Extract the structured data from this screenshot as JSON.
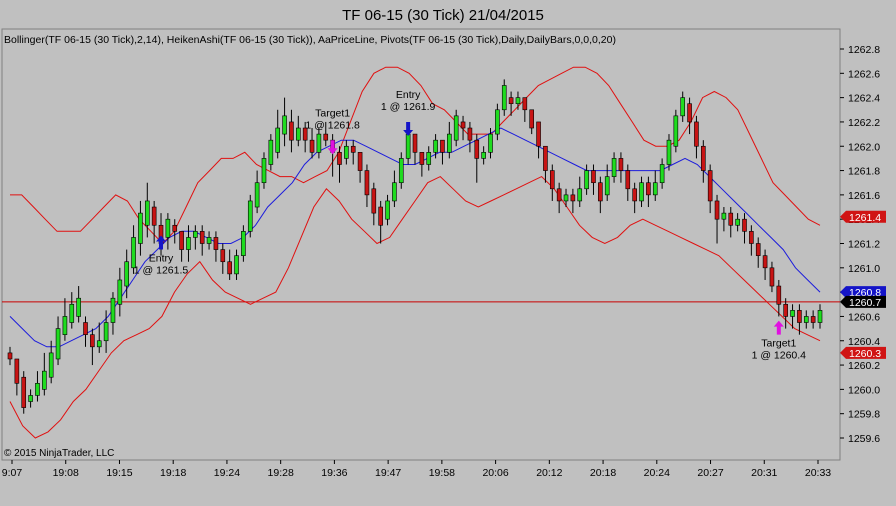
{
  "title": "TF 06-15 (30 Tick)  21/04/2015",
  "indicator_line": "Bollinger(TF 06-15 (30 Tick),2,14), HeikenAshi(TF 06-15 (30 Tick)), AaPriceLine, Pivots(TF 06-15 (30 Tick),Daily,DailyBars,0,0,0,20)",
  "copyright": "© 2015 NinjaTrader, LLC",
  "colors": {
    "background": "#c0c0c0",
    "bull_candle": "#1fdc1f",
    "bear_candle": "#c81414",
    "bollinger_band": "#e01010",
    "bollinger_mid": "#1c1cdc",
    "price_line": "#c80000",
    "entry_arrow": "#1414c8",
    "exit_arrow": "#e010e0"
  },
  "chart_data": {
    "type": "candlestick",
    "y_axis": {
      "min": 1259.6,
      "max": 1262.8,
      "ticks": [
        "1262.8",
        "1262.6",
        "1262.4",
        "1262.2",
        "1262.0",
        "1261.8",
        "1261.6",
        "1261.4",
        "1261.2",
        "1261.0",
        "1260.8",
        "1260.6",
        "1260.4",
        "1260.2",
        "1260.0",
        "1259.8",
        "1259.6"
      ]
    },
    "x_axis": {
      "ticks": [
        "9:07",
        "19:08",
        "19:15",
        "19:18",
        "19:24",
        "19:28",
        "19:36",
        "19:47",
        "19:58",
        "20:06",
        "20:12",
        "20:18",
        "20:24",
        "20:27",
        "20:31",
        "20:33"
      ]
    },
    "axis_badges": [
      {
        "label": "1261.4",
        "value": 1261.42,
        "bg": "#d01414",
        "fg": "#ffffff"
      },
      {
        "label": "1260.8",
        "value": 1260.8,
        "bg": "#1414c8",
        "fg": "#ffffff"
      },
      {
        "label": "1260.7",
        "value": 1260.72,
        "bg": "#000000",
        "fg": "#ffffff"
      },
      {
        "label": "1260.3",
        "value": 1260.3,
        "bg": "#d01414",
        "fg": "#ffffff"
      }
    ],
    "price_line": 1260.72,
    "candles": [
      [
        1260.3,
        1260.25,
        1260.35,
        1260.2
      ],
      [
        1260.25,
        1260.05,
        1260.25,
        1259.95
      ],
      [
        1260.1,
        1259.85,
        1260.15,
        1259.8
      ],
      [
        1259.9,
        1259.95,
        1260.0,
        1259.85
      ],
      [
        1259.95,
        1260.05,
        1260.15,
        1259.9
      ],
      [
        1260.0,
        1260.15,
        1260.3,
        1259.95
      ],
      [
        1260.1,
        1260.3,
        1260.4,
        1260.05
      ],
      [
        1260.25,
        1260.5,
        1260.6,
        1260.2
      ],
      [
        1260.45,
        1260.6,
        1260.75,
        1260.4
      ],
      [
        1260.55,
        1260.7,
        1260.8,
        1260.5
      ],
      [
        1260.6,
        1260.75,
        1260.85,
        1260.55
      ],
      [
        1260.55,
        1260.45,
        1260.6,
        1260.35
      ],
      [
        1260.45,
        1260.35,
        1260.5,
        1260.2
      ],
      [
        1260.35,
        1260.4,
        1260.55,
        1260.3
      ],
      [
        1260.4,
        1260.55,
        1260.65,
        1260.3
      ],
      [
        1260.55,
        1260.75,
        1260.8,
        1260.45
      ],
      [
        1260.7,
        1260.9,
        1261.0,
        1260.6
      ],
      [
        1260.85,
        1261.05,
        1261.15,
        1260.75
      ],
      [
        1261.0,
        1261.25,
        1261.35,
        1260.95
      ],
      [
        1261.2,
        1261.45,
        1261.55,
        1261.1
      ],
      [
        1261.35,
        1261.55,
        1261.7,
        1261.25
      ],
      [
        1261.5,
        1261.35,
        1261.55,
        1261.2
      ],
      [
        1261.35,
        1261.2,
        1261.45,
        1261.1
      ],
      [
        1261.25,
        1261.4,
        1261.45,
        1261.15
      ],
      [
        1261.35,
        1261.3,
        1261.4,
        1261.2
      ],
      [
        1261.3,
        1261.15,
        1261.3,
        1261.05
      ],
      [
        1261.15,
        1261.25,
        1261.35,
        1261.05
      ],
      [
        1261.25,
        1261.3,
        1261.35,
        1261.15
      ],
      [
        1261.3,
        1261.2,
        1261.35,
        1261.1
      ],
      [
        1261.2,
        1261.25,
        1261.3,
        1261.15
      ],
      [
        1261.25,
        1261.15,
        1261.3,
        1261.05
      ],
      [
        1261.15,
        1261.05,
        1261.2,
        1260.95
      ],
      [
        1261.05,
        1260.95,
        1261.15,
        1260.9
      ],
      [
        1260.95,
        1261.1,
        1261.15,
        1260.9
      ],
      [
        1261.1,
        1261.3,
        1261.35,
        1261.05
      ],
      [
        1261.3,
        1261.55,
        1261.6,
        1261.25
      ],
      [
        1261.5,
        1261.7,
        1261.8,
        1261.45
      ],
      [
        1261.7,
        1261.9,
        1261.95,
        1261.65
      ],
      [
        1261.85,
        1262.05,
        1262.1,
        1261.8
      ],
      [
        1261.95,
        1262.15,
        1262.3,
        1261.9
      ],
      [
        1262.1,
        1262.25,
        1262.4,
        1262.0
      ],
      [
        1262.2,
        1262.05,
        1262.3,
        1261.95
      ],
      [
        1262.05,
        1262.15,
        1262.25,
        1262.0
      ],
      [
        1262.15,
        1262.05,
        1262.2,
        1261.95
      ],
      [
        1262.05,
        1261.95,
        1262.15,
        1261.9
      ],
      [
        1261.95,
        1262.1,
        1262.15,
        1261.9
      ],
      [
        1262.1,
        1262.05,
        1262.2,
        1262.0
      ],
      [
        1262.05,
        1261.95,
        1262.1,
        1261.75
      ],
      [
        1261.95,
        1261.85,
        1262.0,
        1261.7
      ],
      [
        1261.9,
        1262.0,
        1262.05,
        1261.85
      ],
      [
        1262.0,
        1261.95,
        1262.05,
        1261.85
      ],
      [
        1261.95,
        1261.8,
        1261.95,
        1261.7
      ],
      [
        1261.8,
        1261.6,
        1261.85,
        1261.5
      ],
      [
        1261.65,
        1261.45,
        1261.7,
        1261.35
      ],
      [
        1261.5,
        1261.35,
        1261.55,
        1261.2
      ],
      [
        1261.4,
        1261.55,
        1261.6,
        1261.35
      ],
      [
        1261.55,
        1261.7,
        1261.8,
        1261.5
      ],
      [
        1261.7,
        1261.9,
        1261.95,
        1261.65
      ],
      [
        1261.9,
        1262.1,
        1262.15,
        1261.85
      ],
      [
        1262.1,
        1261.95,
        1262.1,
        1261.85
      ],
      [
        1261.95,
        1261.85,
        1261.95,
        1261.75
      ],
      [
        1261.85,
        1261.95,
        1262.0,
        1261.8
      ],
      [
        1261.95,
        1262.05,
        1262.1,
        1261.9
      ],
      [
        1262.05,
        1261.95,
        1262.05,
        1261.85
      ],
      [
        1261.95,
        1262.1,
        1262.2,
        1261.9
      ],
      [
        1262.05,
        1262.25,
        1262.3,
        1262.0
      ],
      [
        1262.2,
        1262.15,
        1262.25,
        1262.05
      ],
      [
        1262.15,
        1262.05,
        1262.2,
        1261.95
      ],
      [
        1262.05,
        1261.9,
        1262.1,
        1261.7
      ],
      [
        1261.9,
        1261.95,
        1262.0,
        1261.85
      ],
      [
        1261.95,
        1262.1,
        1262.15,
        1261.9
      ],
      [
        1262.1,
        1262.3,
        1262.35,
        1262.05
      ],
      [
        1262.3,
        1262.5,
        1262.55,
        1262.25
      ],
      [
        1262.4,
        1262.35,
        1262.45,
        1262.25
      ],
      [
        1262.35,
        1262.4,
        1262.45,
        1262.3
      ],
      [
        1262.4,
        1262.3,
        1262.4,
        1262.2
      ],
      [
        1262.3,
        1262.15,
        1262.3,
        1262.1
      ],
      [
        1262.2,
        1262.0,
        1262.2,
        1261.9
      ],
      [
        1262.0,
        1261.8,
        1262.0,
        1261.7
      ],
      [
        1261.8,
        1261.65,
        1261.85,
        1261.55
      ],
      [
        1261.65,
        1261.55,
        1261.7,
        1261.45
      ],
      [
        1261.55,
        1261.6,
        1261.65,
        1261.5
      ],
      [
        1261.6,
        1261.55,
        1261.65,
        1261.45
      ],
      [
        1261.55,
        1261.65,
        1261.75,
        1261.5
      ],
      [
        1261.65,
        1261.8,
        1261.85,
        1261.6
      ],
      [
        1261.8,
        1261.7,
        1261.85,
        1261.6
      ],
      [
        1261.7,
        1261.55,
        1261.75,
        1261.45
      ],
      [
        1261.6,
        1261.75,
        1261.85,
        1261.55
      ],
      [
        1261.75,
        1261.9,
        1261.95,
        1261.7
      ],
      [
        1261.9,
        1261.8,
        1261.95,
        1261.7
      ],
      [
        1261.8,
        1261.65,
        1261.85,
        1261.55
      ],
      [
        1261.65,
        1261.55,
        1261.7,
        1261.45
      ],
      [
        1261.55,
        1261.7,
        1261.75,
        1261.5
      ],
      [
        1261.7,
        1261.6,
        1261.75,
        1261.5
      ],
      [
        1261.6,
        1261.7,
        1261.8,
        1261.55
      ],
      [
        1261.7,
        1261.85,
        1261.9,
        1261.65
      ],
      [
        1261.85,
        1262.05,
        1262.1,
        1261.8
      ],
      [
        1262.0,
        1262.25,
        1262.3,
        1261.95
      ],
      [
        1262.25,
        1262.4,
        1262.45,
        1262.2
      ],
      [
        1262.35,
        1262.2,
        1262.4,
        1262.1
      ],
      [
        1262.2,
        1262.0,
        1262.25,
        1261.9
      ],
      [
        1262.0,
        1261.8,
        1262.05,
        1261.7
      ],
      [
        1261.8,
        1261.55,
        1261.85,
        1261.45
      ],
      [
        1261.55,
        1261.4,
        1261.6,
        1261.2
      ],
      [
        1261.4,
        1261.45,
        1261.5,
        1261.3
      ],
      [
        1261.45,
        1261.35,
        1261.5,
        1261.25
      ],
      [
        1261.35,
        1261.4,
        1261.45,
        1261.3
      ],
      [
        1261.4,
        1261.3,
        1261.45,
        1261.2
      ],
      [
        1261.3,
        1261.2,
        1261.35,
        1261.1
      ],
      [
        1261.2,
        1261.1,
        1261.25,
        1261.0
      ],
      [
        1261.1,
        1261.0,
        1261.15,
        1260.9
      ],
      [
        1261.0,
        1260.85,
        1261.05,
        1260.8
      ],
      [
        1260.85,
        1260.7,
        1260.9,
        1260.6
      ],
      [
        1260.7,
        1260.6,
        1260.75,
        1260.5
      ],
      [
        1260.6,
        1260.65,
        1260.7,
        1260.5
      ],
      [
        1260.65,
        1260.55,
        1260.7,
        1260.45
      ],
      [
        1260.55,
        1260.6,
        1260.65,
        1260.5
      ],
      [
        1260.6,
        1260.55,
        1260.65,
        1260.5
      ],
      [
        1260.55,
        1260.65,
        1260.7,
        1260.5
      ]
    ],
    "bollinger_upper": [
      1261.6,
      1261.6,
      1261.5,
      1261.4,
      1261.3,
      1261.3,
      1261.3,
      1261.4,
      1261.5,
      1261.6,
      1261.55,
      1261.4,
      1261.3,
      1261.2,
      1261.3,
      1261.5,
      1261.7,
      1261.8,
      1261.9,
      1261.9,
      1261.95,
      1261.85,
      1261.8,
      1261.75,
      1261.75,
      1261.7,
      1261.75,
      1261.8,
      1261.95,
      1262.2,
      1262.45,
      1262.6,
      1262.65,
      1262.65,
      1262.6,
      1262.5,
      1262.35,
      1262.3,
      1262.2,
      1262.1,
      1262.1,
      1262.1,
      1262.2,
      1262.3,
      1262.4,
      1262.5,
      1262.55,
      1262.6,
      1262.65,
      1262.65,
      1262.6,
      1262.5,
      1262.35,
      1262.2,
      1262.05,
      1262.0,
      1262.0,
      1262.05,
      1262.2,
      1262.4,
      1262.45,
      1262.4,
      1262.3,
      1262.1,
      1261.9,
      1261.7,
      1261.6,
      1261.5,
      1261.4,
      1261.35
    ],
    "bollinger_mid": [
      1260.6,
      1260.5,
      1260.4,
      1260.35,
      1260.35,
      1260.4,
      1260.45,
      1260.5,
      1260.6,
      1260.75,
      1260.9,
      1261.05,
      1261.15,
      1261.25,
      1261.3,
      1261.3,
      1261.25,
      1261.2,
      1261.2,
      1261.25,
      1261.35,
      1261.5,
      1261.6,
      1261.7,
      1261.85,
      1261.95,
      1262.0,
      1262.05,
      1262.05,
      1262.0,
      1261.95,
      1261.9,
      1261.85,
      1261.85,
      1261.9,
      1261.95,
      1261.95,
      1262.0,
      1262.05,
      1262.1,
      1262.15,
      1262.1,
      1262.05,
      1262.0,
      1261.95,
      1261.9,
      1261.85,
      1261.8,
      1261.8,
      1261.8,
      1261.8,
      1261.8,
      1261.8,
      1261.8,
      1261.85,
      1261.9,
      1261.85,
      1261.75,
      1261.65,
      1261.55,
      1261.45,
      1261.35,
      1261.25,
      1261.15,
      1261.0,
      1260.9,
      1260.8
    ],
    "bollinger_lower": [
      1259.9,
      1259.7,
      1259.6,
      1259.65,
      1259.75,
      1259.9,
      1260.0,
      1260.15,
      1260.3,
      1260.4,
      1260.45,
      1260.5,
      1260.6,
      1260.8,
      1260.95,
      1261.05,
      1260.9,
      1260.8,
      1260.75,
      1260.7,
      1260.75,
      1260.8,
      1261.0,
      1261.25,
      1261.5,
      1261.65,
      1261.55,
      1261.4,
      1261.3,
      1261.2,
      1261.25,
      1261.4,
      1261.55,
      1261.7,
      1261.75,
      1261.65,
      1261.55,
      1261.5,
      1261.55,
      1261.6,
      1261.65,
      1261.7,
      1261.75,
      1261.65,
      1261.5,
      1261.35,
      1261.25,
      1261.2,
      1261.25,
      1261.35,
      1261.4,
      1261.35,
      1261.3,
      1261.25,
      1261.2,
      1261.15,
      1261.1,
      1261.0,
      1260.9,
      1260.8,
      1260.7,
      1260.6,
      1260.5,
      1260.45,
      1260.4
    ],
    "annotations": [
      {
        "kind": "entry",
        "text1": "Entry",
        "text2": "1 @ 1261.5",
        "bar": 22,
        "price": 1261.2,
        "dir": "up"
      },
      {
        "kind": "exit",
        "text1": "Target1",
        "text2": "1 @ 1261.8",
        "bar": 47,
        "price": 1262.0,
        "dir": "down"
      },
      {
        "kind": "entry",
        "text1": "Entry",
        "text2": "1 @ 1261.9",
        "bar": 58,
        "price": 1262.15,
        "dir": "down"
      },
      {
        "kind": "exit",
        "text1": "Target1",
        "text2": "1 @ 1260.4",
        "bar": 112,
        "price": 1260.5,
        "dir": "up"
      }
    ]
  }
}
